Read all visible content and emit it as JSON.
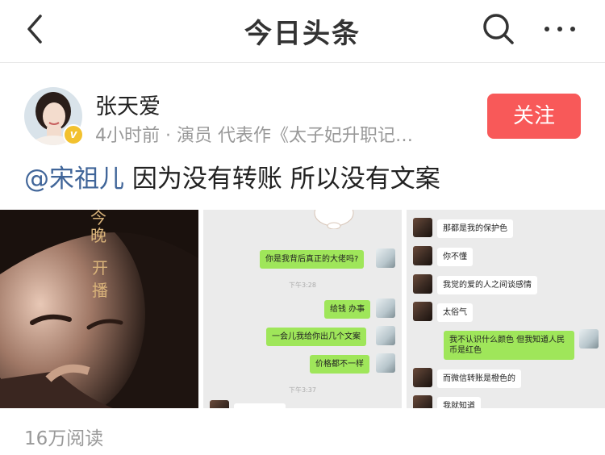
{
  "nav": {
    "title": "今日头条"
  },
  "author": {
    "name": "张天爱",
    "meta": "4小时前 · 演员 代表作《太子妃升职记…",
    "badge": "v",
    "follow_label": "关注"
  },
  "post": {
    "mention": "@宋祖儿",
    "text": " 因为没有转账 所以没有文案"
  },
  "poster": {
    "line1": "今",
    "line2": "晚",
    "line3": "开",
    "line4": "播"
  },
  "chat1": {
    "msg1": "你是我背后真正的大佬吗?",
    "time1": "下午3:28",
    "msg2": "给钱 办事",
    "msg3": "一会儿我给你出几个文案",
    "msg4": "价格都不一样",
    "time2": "下午3:37"
  },
  "chat2": {
    "msg1": "那都是我的保护色",
    "msg2": "你不懂",
    "msg3": "我觉的爱的人之间谈感情",
    "msg4": "太俗气",
    "msg5": "我不认识什么颜色 但我知道人民币是红色",
    "msg6": "而微信转账是橙色的",
    "msg7": "我就知道"
  },
  "footer": {
    "read_count": "16万阅读"
  },
  "colors": {
    "accent": "#f85959",
    "mention": "#406599",
    "badge": "#f2c12e",
    "wechat_green": "#9fe65a"
  }
}
